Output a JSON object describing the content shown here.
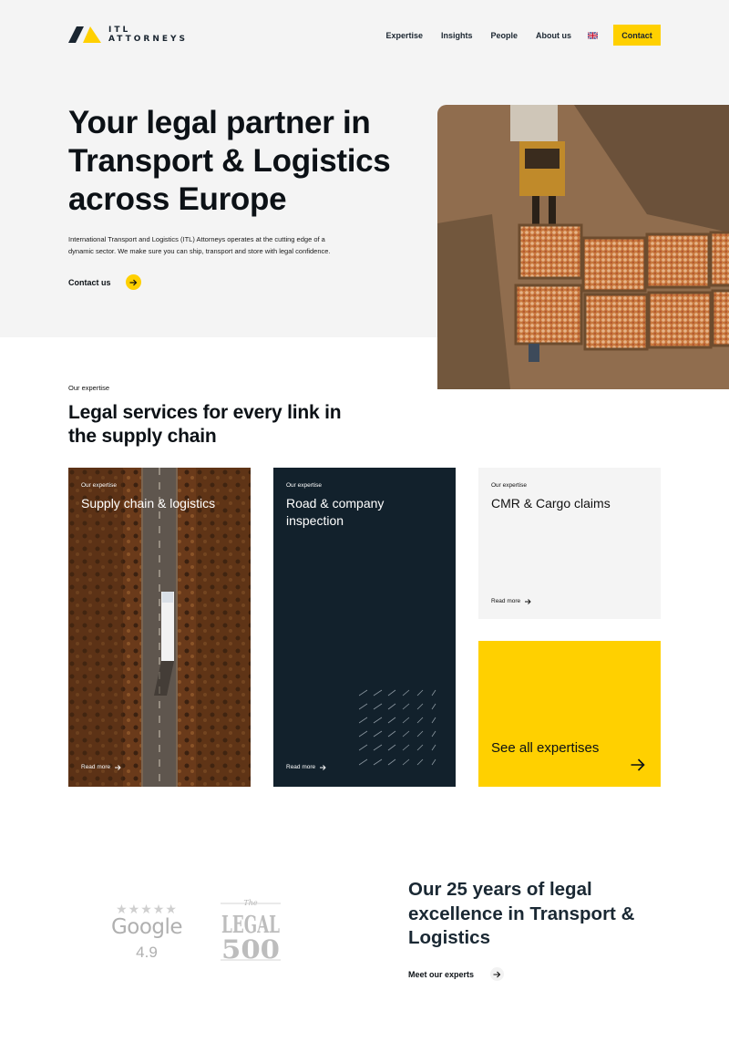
{
  "brand": {
    "name_line1": "ITL",
    "name_line2": "ATTORNEYS",
    "colors": {
      "accent": "#ffd000",
      "navy": "#12212c",
      "light_bg": "#f4f4f4"
    }
  },
  "nav": {
    "items": [
      "Expertise",
      "Insights",
      "People",
      "About us"
    ],
    "language_icon": "uk-flag-icon",
    "contact_label": "Contact"
  },
  "hero": {
    "title": "Your legal partner in Transport & Logistics across Europe",
    "text": "International Transport and Logistics (ITL) Attorneys operates at the cutting edge of a dynamic sector. We make sure you can ship, transport and store with legal confidence.",
    "cta_label": "Contact us",
    "cta_icon": "arrow-right-icon",
    "photo": "aerial-forklift-apple-crates-image"
  },
  "expertise": {
    "label": "Our expertise",
    "title": "Legal services for every link in the supply chain",
    "cards": [
      {
        "kicker": "Our expertise",
        "title": "Supply chain & logistics",
        "more": "Read more",
        "image": "aerial-truck-road-image"
      },
      {
        "kicker": "Our expertise",
        "title": "Road & company inspection",
        "more": "Read more",
        "pattern": "diagonal-lines-pattern"
      },
      {
        "kicker": "Our expertise",
        "title": "CMR & Cargo claims",
        "more": "Read more"
      }
    ],
    "see_all": {
      "title": "See all expertises",
      "icon": "arrow-right-icon"
    }
  },
  "awards": {
    "google": {
      "stars": "★★★★★",
      "word": "Google",
      "score": "4.9"
    },
    "legal500": {
      "the": "The",
      "legal": "LEGAL",
      "number": "500"
    },
    "title": "Our 25 years of legal excellence in Transport & Logistics",
    "cta_label": "Meet our experts",
    "cta_icon": "arrow-right-icon"
  }
}
